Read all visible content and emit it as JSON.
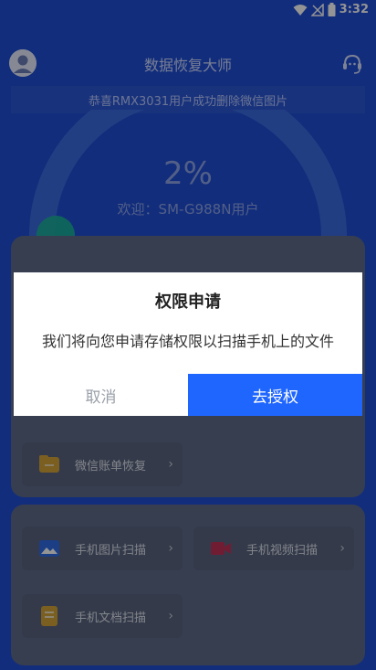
{
  "status_bar": {
    "time": "3:32"
  },
  "header": {
    "title": "数据恢复大师"
  },
  "notice": {
    "text": "恭喜RMX3031用户成功删除微信图片"
  },
  "progress": {
    "percent_text": "2%",
    "welcome_text": "欢迎：SM-G988N用户"
  },
  "card1": {
    "tiles": [
      {
        "label": "微信账单恢复"
      }
    ]
  },
  "card2": {
    "tiles": [
      {
        "label": "手机图片扫描"
      },
      {
        "label": "手机视频扫描"
      },
      {
        "label": "手机文档扫描"
      }
    ]
  },
  "dialog": {
    "title": "权限申请",
    "message": "我们将向您申请存储权限以扫描手机上的文件",
    "cancel_label": "取消",
    "confirm_label": "去授权"
  },
  "icons": {
    "wifi": "wifi-icon",
    "signal": "signal-off-icon",
    "battery": "battery-icon",
    "avatar": "user-avatar-icon",
    "support": "customer-service-icon"
  }
}
